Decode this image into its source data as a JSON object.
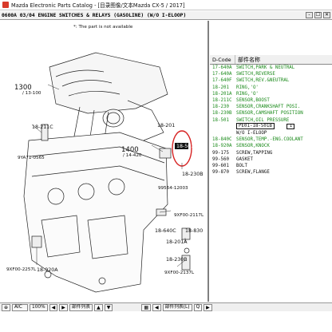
{
  "window": {
    "title": "Mazda Electronic Parts Catalog - [目录图像/文本Mazda CX-5 / 2017]"
  },
  "document": {
    "title": "0600A 03/04 ENGINE SWITCHES & RELAYS (GASOLINE) (W/O I-ELOOP)",
    "window_buttons": [
      "-",
      "☐",
      "✕"
    ]
  },
  "diagram": {
    "note": "*: The part is not available",
    "callouts": [
      {
        "id": "c1300",
        "ref": "1300",
        "sub": "/ 13-100"
      },
      {
        "id": "c1400",
        "ref": "1400",
        "sub": "/ 14-420"
      },
      {
        "id": "c18211c",
        "ref": "18-211C"
      },
      {
        "id": "c9ya71",
        "ref": "9YA71-0565"
      },
      {
        "id": "c18201",
        "ref": "18-201"
      },
      {
        "id": "c18501",
        "ref": "18-501"
      },
      {
        "id": "c18230b",
        "ref": "18-230B"
      },
      {
        "id": "c9956a",
        "ref": "99564-12003"
      },
      {
        "id": "c9xf00a",
        "ref": "9XF00-2117L"
      },
      {
        "id": "c18640c",
        "ref": "18-640C"
      },
      {
        "id": "c18830",
        "ref": "18-830"
      },
      {
        "id": "c18201a",
        "ref": "18-201A"
      },
      {
        "id": "c18230b2",
        "ref": "18-230B"
      },
      {
        "id": "c9xf00b",
        "ref": "9XF00-2257L"
      },
      {
        "id": "c18920a",
        "ref": "18-920A"
      },
      {
        "id": "c9xf00c",
        "ref": "9XF00-2137L"
      }
    ]
  },
  "table": {
    "col_code": "D-Code",
    "col_name": "部件名称",
    "rows": [
      {
        "code": "17-640A",
        "name": "SWITCH,PARK & NEUTRAL",
        "color": "green"
      },
      {
        "code": "17-640A",
        "name": "SWITCH,REVERSE",
        "color": "green"
      },
      {
        "code": "17-640F",
        "name": "SWITCH,REV.&NEUTRAL",
        "color": "green"
      },
      {
        "code": "18-201",
        "name": "RING,'O'",
        "color": "green"
      },
      {
        "code": "18-201A",
        "name": "RING,'O'",
        "color": "green"
      },
      {
        "code": "18-211C",
        "name": "SENSOR,BOOST",
        "color": "green"
      },
      {
        "code": "18-230",
        "name": "SENSOR,CRANKSHAFT POSI.",
        "color": "green"
      },
      {
        "code": "18-230B",
        "name": "SENSOR,CAMSHAFT POSITION",
        "color": "green"
      },
      {
        "code": "18-501",
        "name": "SWITCH,OIL PRESSURE",
        "color": "green"
      },
      {
        "code": "",
        "name": "PE01-18-501B",
        "color": "sel",
        "qty": "1"
      },
      {
        "code": "",
        "name": "W/O I-ELOOP",
        "color": "black"
      },
      {
        "code": "18-840C",
        "name": "SENSOR,TEMP.-ENG.COOLANT",
        "color": "green"
      },
      {
        "code": "18-920A",
        "name": "SENSOR,KNOCK",
        "color": "green"
      },
      {
        "code": "99-175",
        "name": "SCREW,TAPPING",
        "color": "black"
      },
      {
        "code": "99-560",
        "name": "GASKET",
        "color": "black"
      },
      {
        "code": "99-601",
        "name": "BOLT",
        "color": "black"
      },
      {
        "code": "99-870",
        "name": "SCREW,FLANGE",
        "color": "black"
      }
    ]
  },
  "toolbar": {
    "aic": "AIC",
    "zoom": "100%",
    "parts_list": "部件列表",
    "parts_list_right": "部件列表(L)",
    "q": "Q"
  },
  "colors": {
    "green_row": "#1a8a1a",
    "highlight_circle": "#d62020"
  }
}
